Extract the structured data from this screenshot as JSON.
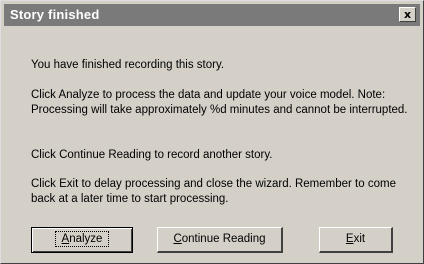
{
  "window": {
    "title": "Story finished",
    "close_label": "x"
  },
  "body": {
    "line1": "You have finished recording this story.",
    "line2": "Click Analyze to process the data and update your voice model. Note: Processing will take approximately %d minutes and cannot be interrupted.",
    "line3": "Click Continue Reading to record another story.",
    "line4": "Click Exit to delay processing and close the wizard. Remember to come back at a later time to start processing."
  },
  "buttons": {
    "analyze": {
      "accel": "A",
      "rest": "nalyze"
    },
    "continue": {
      "accel": "C",
      "rest": "ontinue Reading"
    },
    "exit": {
      "accel": "E",
      "rest": "xit"
    }
  }
}
